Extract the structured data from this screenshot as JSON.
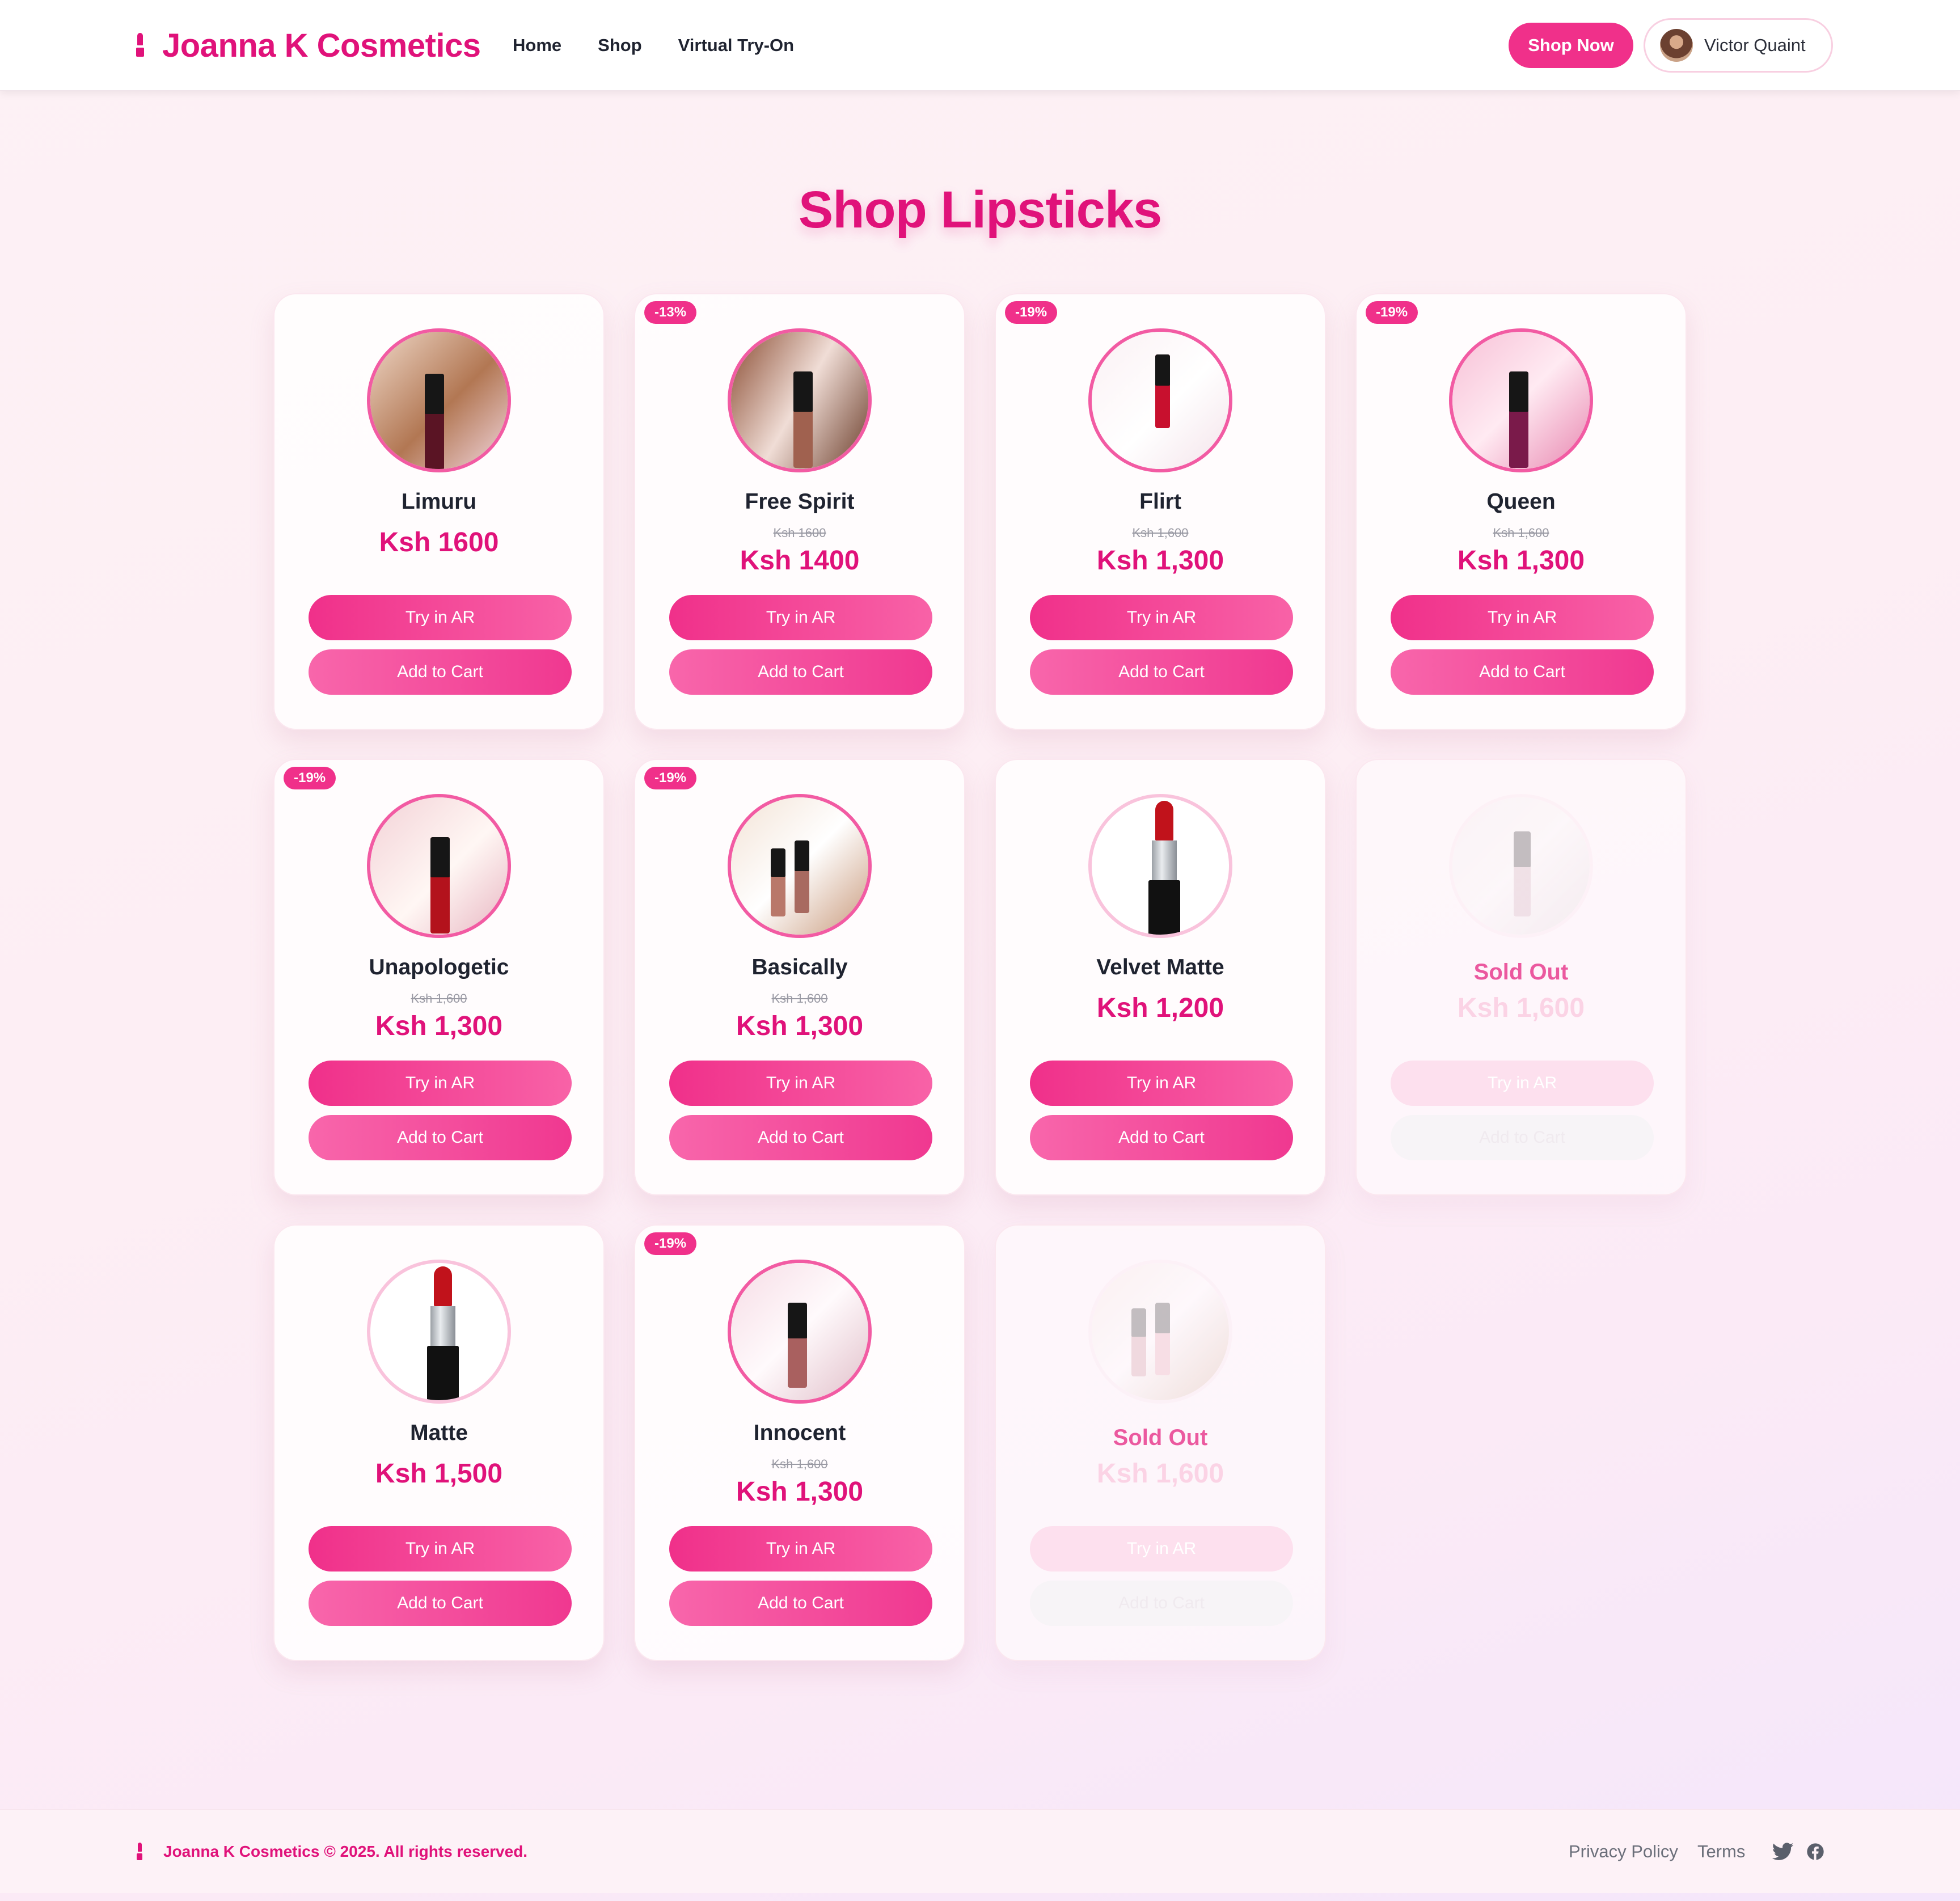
{
  "header": {
    "brand": "Joanna K Cosmetics",
    "nav": [
      "Home",
      "Shop",
      "Virtual Try-On"
    ],
    "cta": "Shop Now",
    "user": "Victor Quaint"
  },
  "page_title": "Shop Lipsticks",
  "buttons": {
    "try_ar": "Try in AR",
    "add_cart": "Add to Cart"
  },
  "sold_out_label": "Sold Out",
  "products": [
    {
      "name": "Limuru",
      "price": "Ksh 1600",
      "old_price": "",
      "badge": ""
    },
    {
      "name": "Free Spirit",
      "price": "Ksh 1400",
      "old_price": "Ksh 1600",
      "badge": "-13%"
    },
    {
      "name": "Flirt",
      "price": "Ksh 1,300",
      "old_price": "Ksh 1,600",
      "badge": "-19%"
    },
    {
      "name": "Queen",
      "price": "Ksh 1,300",
      "old_price": "Ksh 1,600",
      "badge": "-19%"
    },
    {
      "name": "Unapologetic",
      "price": "Ksh 1,300",
      "old_price": "Ksh 1,600",
      "badge": "-19%"
    },
    {
      "name": "Basically",
      "price": "Ksh 1,300",
      "old_price": "Ksh 1,600",
      "badge": "-19%"
    },
    {
      "name": "Velvet Matte",
      "price": "Ksh 1,200",
      "old_price": "",
      "badge": ""
    },
    {
      "name": "",
      "price": "Ksh 1,600",
      "old_price": "",
      "badge": "",
      "sold_out": true
    },
    {
      "name": "Matte",
      "price": "Ksh 1,500",
      "old_price": "",
      "badge": ""
    },
    {
      "name": "Innocent",
      "price": "Ksh 1,300",
      "old_price": "Ksh 1,600",
      "badge": "-19%"
    },
    {
      "name": "",
      "price": "Ksh 1,600",
      "old_price": "",
      "badge": "",
      "sold_out": true
    }
  ],
  "footer": {
    "copyright": "Joanna K Cosmetics © 2025. All rights reserved.",
    "links": [
      "Privacy Policy",
      "Terms"
    ],
    "social": [
      "twitter-icon",
      "facebook-icon"
    ]
  },
  "colors": {
    "brand": "#e0127a",
    "button": "#f0308a",
    "thumb_border": "#f25ba3"
  }
}
